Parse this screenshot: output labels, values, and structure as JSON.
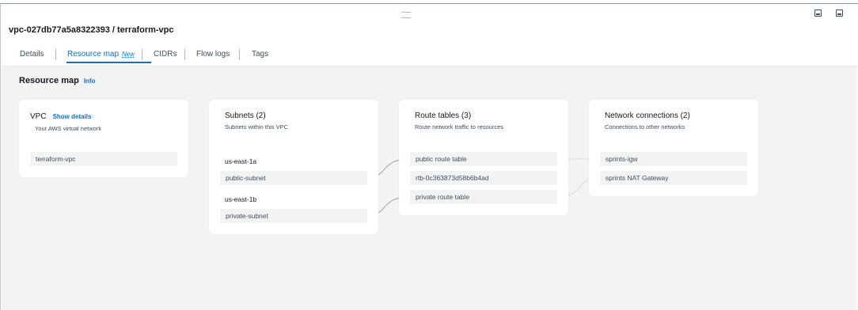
{
  "header": {
    "title": "vpc-027db77a5a8322393 / terraform-vpc"
  },
  "tabs": [
    {
      "label": "Details"
    },
    {
      "label": "Resource map",
      "badge": "New"
    },
    {
      "label": "CIDRs"
    },
    {
      "label": "Flow logs"
    },
    {
      "label": "Tags"
    }
  ],
  "resource_map": {
    "title": "Resource map",
    "info_label": "Info",
    "vpc": {
      "title": "VPC",
      "show_details": "Show details",
      "subtitle": "Your AWS virtual network",
      "items": [
        "terraform-vpc"
      ]
    },
    "subnets": {
      "title": "Subnets (2)",
      "subtitle": "Subnets within this VPC",
      "groups": [
        {
          "az": "us-east-1a",
          "items": [
            "public-subnet"
          ]
        },
        {
          "az": "us-east-1b",
          "items": [
            "private-subnet"
          ]
        }
      ]
    },
    "route_tables": {
      "title": "Route tables (3)",
      "subtitle": "Route network traffic to resources",
      "items": [
        "public route table",
        "rtb-0c363873d58b6b4ad",
        "private route table"
      ]
    },
    "network_connections": {
      "title": "Network connections (2)",
      "subtitle": "Connections to other networks",
      "items": [
        "sprints-igw",
        "sprints NAT Gateway"
      ]
    }
  },
  "colors": {
    "accent": "#0972d3",
    "background": "#f2f3f3",
    "card": "#ffffff",
    "connector": "#8d99a8"
  }
}
